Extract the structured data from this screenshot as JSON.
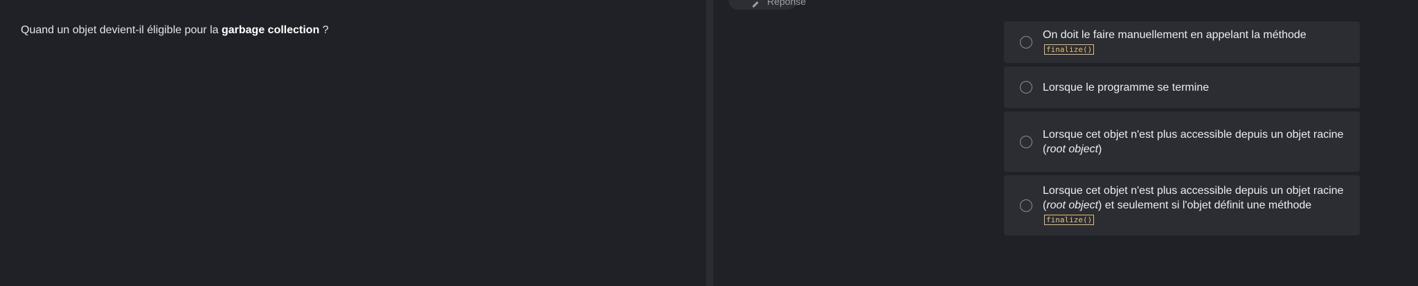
{
  "question": {
    "prefix": "Quand un objet devient-il éligible pour la",
    "bold": "garbage collection",
    "suffix": " ?"
  },
  "answer_tab": {
    "label": "Réponse"
  },
  "options": [
    {
      "text_before": "On doit le faire manuellement en appelant la méthode",
      "code": "finalize()"
    },
    {
      "text": "Lorsque le programme se termine"
    },
    {
      "text_before": "Lorsque cet objet n'est plus accessible depuis un objet racine (",
      "italic": "root object",
      "text_after": ")"
    },
    {
      "text_before": "Lorsque cet objet n'est plus accessible depuis un objet racine (",
      "italic": "root object",
      "text_after": ") et seulement si l'objet définit une méthode",
      "code": "finalize()"
    }
  ]
}
